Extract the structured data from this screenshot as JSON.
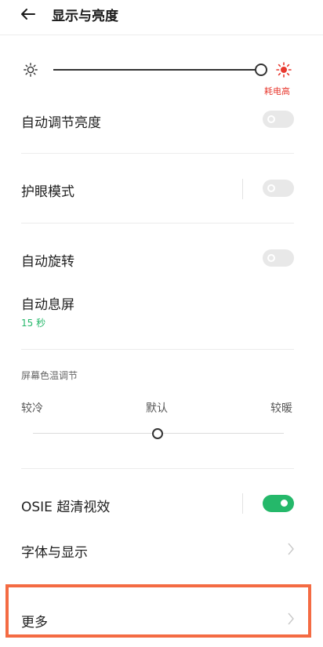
{
  "header": {
    "title": "显示与亮度",
    "back_icon": "arrow-left-icon"
  },
  "brightness": {
    "low_icon": "sun-outline-icon",
    "high_icon": "sun-filled-icon",
    "level_percent": 100,
    "warning": "耗电高",
    "accent_color": "#e8392f"
  },
  "settings": {
    "auto_brightness": {
      "label": "自动调节亮度",
      "on": false
    },
    "eye_care": {
      "label": "护眼模式",
      "on": false
    },
    "auto_rotate": {
      "label": "自动旋转",
      "on": false
    },
    "screen_timeout": {
      "label": "自动息屏",
      "value": "15 秒"
    }
  },
  "color_temp": {
    "title": "屏幕色温调节",
    "cold": "较冷",
    "default": "默认",
    "warm": "较暖",
    "position_percent": 50
  },
  "osie": {
    "label": "OSIE 超清视效",
    "on": true,
    "on_color": "#25b86a"
  },
  "font_display": {
    "label": "字体与显示"
  },
  "more": {
    "label": "更多",
    "highlight_color": "#f46b43"
  }
}
